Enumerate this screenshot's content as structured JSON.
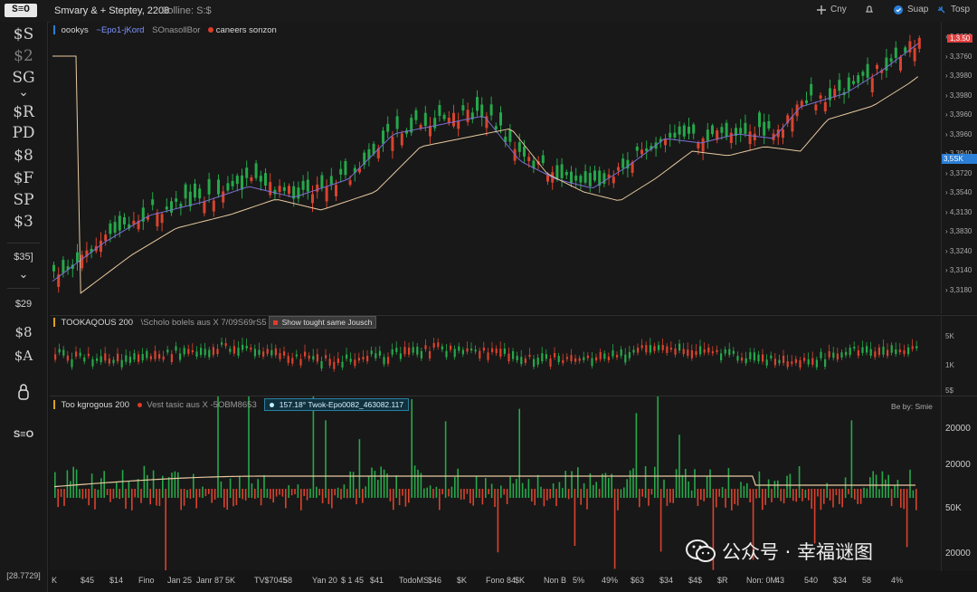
{
  "app": {
    "logo": "S≡O",
    "title": "Smvary & + Steptey, 2208",
    "session": "Solline: S:$"
  },
  "toolbar": {
    "buttons": [
      {
        "label": "Cny",
        "icon": "crosshair-icon"
      },
      {
        "label": "",
        "icon": "alert-icon"
      },
      {
        "label": "Suap",
        "icon": "snapshot-icon"
      },
      {
        "label": "Tosp",
        "icon": "reset-icon"
      }
    ]
  },
  "sidebar": {
    "items": [
      "$S",
      "$2",
      "SG",
      "⌄",
      "$R",
      "PD",
      "$8",
      "$F",
      "SP",
      "$3"
    ],
    "extra": [
      "$35]",
      "⌄",
      "$29",
      "$8",
      "$A",
      "",
      "S≡O"
    ],
    "bottom": "[28.7729]"
  },
  "panes": {
    "price": {
      "legend_name": "oookys",
      "legend_items": [
        "~Epo1-jKord",
        "SOnasollBor",
        "caneers sonzon"
      ],
      "price_badge": "1,3.50",
      "last_badge": "3,5SK",
      "ticks": [
        "3,3850",
        "3,3760",
        "3,3980",
        "3,3980",
        "3,3960",
        "3,3960",
        "3,3940",
        "3,3720",
        "3,3540",
        "4,3130",
        "3,3830",
        "3,3240",
        "3,3140",
        "3,3180"
      ]
    },
    "osc": {
      "legend_name": "TOOKAQOUS 200",
      "legend_sub": "\\Scholo bolels aus  X 7/09S69rS5",
      "badge": "Show tought same Jousch",
      "ticks": [
        "5K",
        "1K",
        "5$"
      ]
    },
    "volume": {
      "legend_name": "Too kgrogous 200",
      "legend_sub": "Vest tasic aus  X -5OBM8653",
      "badge": "157.18° Twok-Epo0082_463082.117",
      "right_label": "Be by: Smie",
      "ticks": [
        "20000",
        "20000",
        "50K",
        "20000"
      ]
    }
  },
  "xaxis": {
    "labels": [
      "K",
      "$45",
      "$14",
      "Fino",
      "Jan 25",
      "Janr 87",
      "5K",
      "TV$7045",
      "58",
      "Yan 20",
      "$ 1 45",
      "$41",
      "TodoMS",
      "$46",
      "$K",
      "Fono 84",
      "$K",
      "Non B",
      "5%",
      "49%",
      "$63",
      "$34",
      "$4$",
      "$R",
      "Non: 0M",
      "43",
      "540",
      "$34",
      "58",
      "4%"
    ]
  },
  "watermark": {
    "text": "公众号 · 幸福谜图",
    "icon": "wechat-icon"
  },
  "colors": {
    "up": "#26a84a",
    "down": "#d9432e",
    "ma_fast": "#7c6fd6",
    "ma_slow": "#e8c9a0",
    "accent": "#2b7fd6"
  }
}
